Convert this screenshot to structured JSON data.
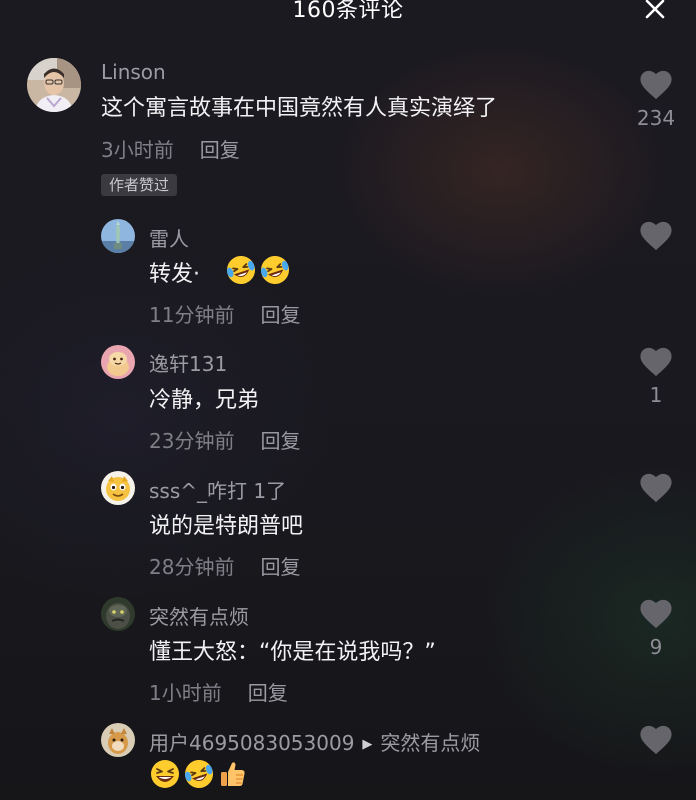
{
  "header": {
    "title": "160条评论",
    "close_icon": "close-icon"
  },
  "comments": [
    {
      "author": "Linson",
      "text": "这个寓言故事在中国竟然有人真实演绎了",
      "time": "3小时前",
      "reply_label": "回复",
      "badge": "作者赞过",
      "likes": "234"
    },
    {
      "author": "雷人",
      "text": "转发·",
      "emojis": [
        "laughing-tears-emoji",
        "laughing-tears-emoji"
      ],
      "time": "11分钟前",
      "reply_label": "回复",
      "likes": ""
    },
    {
      "author": "逸轩131",
      "text": "冷静，兄弟",
      "time": "23分钟前",
      "reply_label": "回复",
      "likes": "1"
    },
    {
      "author": "sss^_咋打 1了",
      "text": "说的是特朗普吧",
      "time": "28分钟前",
      "reply_label": "回复",
      "likes": ""
    },
    {
      "author": "突然有点烦",
      "text": "懂王大怒：“你是在说我吗？”",
      "time": "1小时前",
      "reply_label": "回复",
      "likes": "9"
    },
    {
      "author": "用户4695083053009",
      "reply_to": "突然有点烦",
      "emojis": [
        "grinning-squint-emoji",
        "laughing-tears-emoji",
        "thumbs-up-emoji"
      ],
      "likes": ""
    }
  ],
  "colors": {
    "background": "#1a1920",
    "primary_text": "#f2f2f4",
    "secondary_text": "#9c9ba3",
    "meta_text": "#807f87",
    "heart_icon": "#66656c"
  },
  "icons": {
    "like": "heart-icon",
    "reply_arrow": "play-arrow-icon"
  }
}
